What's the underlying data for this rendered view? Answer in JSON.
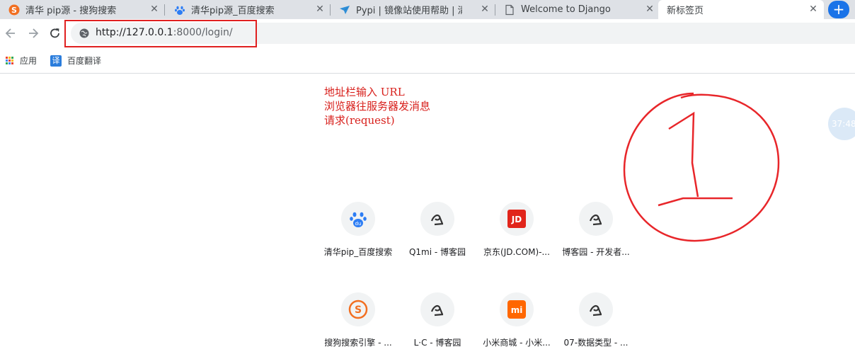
{
  "tabs": [
    {
      "title": "清华 pip源 - 搜狗搜索",
      "icon": "sogou-icon",
      "active": false
    },
    {
      "title": "清华pip源_百度搜索",
      "icon": "baidu-paw-icon",
      "active": false
    },
    {
      "title": "Pypi | 镜像站使用帮助 | 清华大",
      "icon": "tsinghua-icon",
      "active": false
    },
    {
      "title": "Welcome to Django",
      "icon": "document-icon",
      "active": false
    },
    {
      "title": "新标签页",
      "icon": "none",
      "active": true
    }
  ],
  "new_tab_symbol": "+",
  "close_symbol": "✕",
  "address": {
    "host": "http://127.0.0.1",
    "rest": ":8000/login/"
  },
  "bookmarks": {
    "apps_label": "应用",
    "fanyi_label": "百度翻译",
    "fanyi_icon_char": "译"
  },
  "note": {
    "line1": "地址栏输入 URL",
    "line2": "浏览器往服务器发消息",
    "line3": "请求(request)"
  },
  "shortcuts": [
    {
      "label": "清华pip_百度搜索",
      "icon": "baidu-icon"
    },
    {
      "label": "Q1mi - 博客园",
      "icon": "cnblogs-icon"
    },
    {
      "label": "京东(JD.COM)-...",
      "icon": "jd-icon"
    },
    {
      "label": "博客园 - 开发者...",
      "icon": "cnblogs-icon"
    },
    {
      "label": "搜狗搜索引擎 - ...",
      "icon": "sogou-icon"
    },
    {
      "label": "L·C - 博客园",
      "icon": "cnblogs-icon"
    },
    {
      "label": "小米商城 - 小米...",
      "icon": "mi-icon"
    },
    {
      "label": "07-数据类型 - ...",
      "icon": "cnblogs-icon"
    }
  ],
  "icon_text": {
    "jd": "JD",
    "mi": "mi",
    "baidu": "du",
    "sogou": "S"
  },
  "clock_text": "37:48",
  "colors": {
    "annotation_red": "#d8201c",
    "tab_strip": "#dee1e6",
    "accent_blue": "#1a73e8"
  }
}
